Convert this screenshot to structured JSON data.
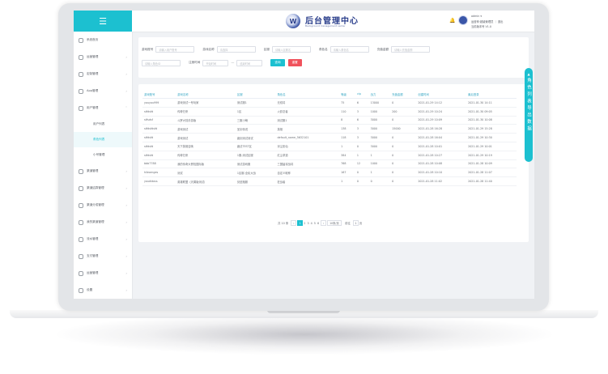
{
  "header": {
    "logo_glyph": "W",
    "title": "后台管理中心",
    "subtitle": "Background management center",
    "bell_icon": "bell-icon",
    "user_line1": "admin ▾",
    "user_line2": "运营商·超级管理员 ｜ 退出",
    "user_line3": "当前版本号 V1.0"
  },
  "sidebar": {
    "toggle_icon": "☰",
    "items": [
      {
        "label": "系统首页",
        "icon": "home-icon"
      },
      {
        "label": "运营管理",
        "icon": "settings-icon",
        "arrow": "›"
      },
      {
        "label": "定制管理",
        "icon": "pen-icon",
        "arrow": "›"
      },
      {
        "label": "App管理",
        "icon": "app-icon",
        "arrow": "›"
      },
      {
        "label": "用户管理",
        "icon": "user-icon",
        "arrow": "˅"
      }
    ],
    "sub_items": [
      {
        "label": "用户列表"
      },
      {
        "label": "角色列表"
      },
      {
        "label": "小号管理"
      }
    ],
    "items2": [
      {
        "label": "渠道管理",
        "arrow": "›"
      },
      {
        "label": "渠道结算管理",
        "arrow": "›"
      },
      {
        "label": "渠道分成管理",
        "arrow": "›"
      },
      {
        "label": "我的渠道管理",
        "arrow": "›"
      },
      {
        "label": "流水管理",
        "arrow": "›"
      },
      {
        "label": "支付管理",
        "arrow": "›"
      },
      {
        "label": "运营管理",
        "arrow": "›"
      },
      {
        "label": "设置",
        "arrow": "›"
      }
    ]
  },
  "filters": {
    "row1": [
      {
        "label": "游戏账号",
        "placeholder": "请输入用户账号"
      },
      {
        "label": "游戏名称",
        "placeholder": "请选择"
      },
      {
        "label": "区服",
        "placeholder": "请输入区服名"
      },
      {
        "label": "角色名",
        "placeholder": "请输入角色名"
      },
      {
        "label": "充值金额",
        "placeholder": "请输入充值金额"
      }
    ],
    "row2_first_placeholder": "请输入角色ID",
    "date_label": "注册时间",
    "date_start": "开始时间",
    "date_end": "结束时间",
    "date_dash": "—",
    "query_button": "查询",
    "reset_button": "重置"
  },
  "table": {
    "columns": [
      "游戏账号",
      "游戏名称",
      "区服",
      "角色名",
      "等级",
      "vip",
      "战力",
      "充值金额",
      "创建时间",
      "最后登录"
    ],
    "rows": [
      [
        "youyou999",
        "游戏测试一号玩家",
        "测试服1",
        "无双将",
        "75",
        "6",
        "13000",
        "0",
        "2021-01-29 14:12",
        "2021-01-30 14:11"
      ],
      [
        "stfdsfd",
        "传奇归来",
        "1区",
        "火影忍者",
        "110",
        "3",
        "1000",
        "200",
        "2021-01-29 10:24",
        "2021-01-30 09:05"
      ],
      [
        "stfsdsf",
        "斗罗大陆手游版",
        "三服小萌",
        "测试服1",
        "8",
        "6",
        "3000",
        "0",
        "2021-01-29 10:09",
        "2021-01-30 10:08"
      ],
      [
        "stfdsfdsfd",
        "游戏测试",
        "圣剑传说",
        "英雄",
        "138",
        "3",
        "3000",
        "15000",
        "2021-01-28 16:28",
        "2021-01-29 15:28"
      ],
      [
        "stfdsfd",
        "游戏测试",
        "魔剑测试测试",
        "default_name_5632101",
        "118",
        "3",
        "3000",
        "0",
        "2021-01-28 16:04",
        "2021-01-29 10:30"
      ],
      [
        "stfdsfd",
        "天下英雄召唤",
        "魔法TEST区",
        "浮尘影仙",
        "1",
        "0",
        "3000",
        "0",
        "2021-01-28 10:01",
        "2021-01-29 10:01"
      ],
      [
        "stfdsfd",
        "传奇归来",
        "1服-测试区服",
        "红尘求道",
        "384",
        "1",
        "1",
        "0",
        "2021-01-28 10:27",
        "2021-01-29 10:19"
      ],
      [
        "bbb7788",
        "我的传奇大冒险国际版",
        "测试游戏服",
        "三国猛将战将",
        "768",
        "12",
        "1000",
        "0",
        "2021-01-28 10:08",
        "2021-01-28 10:09"
      ],
      [
        "hilearnges",
        "测试",
        "1区服-全民大战",
        "自定义昵称",
        "167",
        "0",
        "1",
        "0",
        "2021-01-28 10:10",
        "2021-01-28 11:07"
      ],
      [
        "youdidoss",
        "英雄联盟（天翼版测试）",
        "剑圣跑服",
        "狂战者",
        "1",
        "0",
        "0",
        "0",
        "2021-01-28 11:02",
        "2021-01-28 11:40"
      ]
    ]
  },
  "pagination": {
    "total": "共 10 条",
    "prev": "‹",
    "pages": [
      "1",
      "2",
      "3",
      "4",
      "5",
      "6"
    ],
    "next": "›",
    "page_size": "10条/页",
    "goto_label": "前往",
    "goto_value": "1",
    "goto_suffix": "页"
  },
  "float_tab": {
    "label": "角色列表导出数据"
  },
  "colors": {
    "accent": "#1cc0d0",
    "danger": "#f0525c",
    "brand_blue": "#2b3f8c"
  }
}
